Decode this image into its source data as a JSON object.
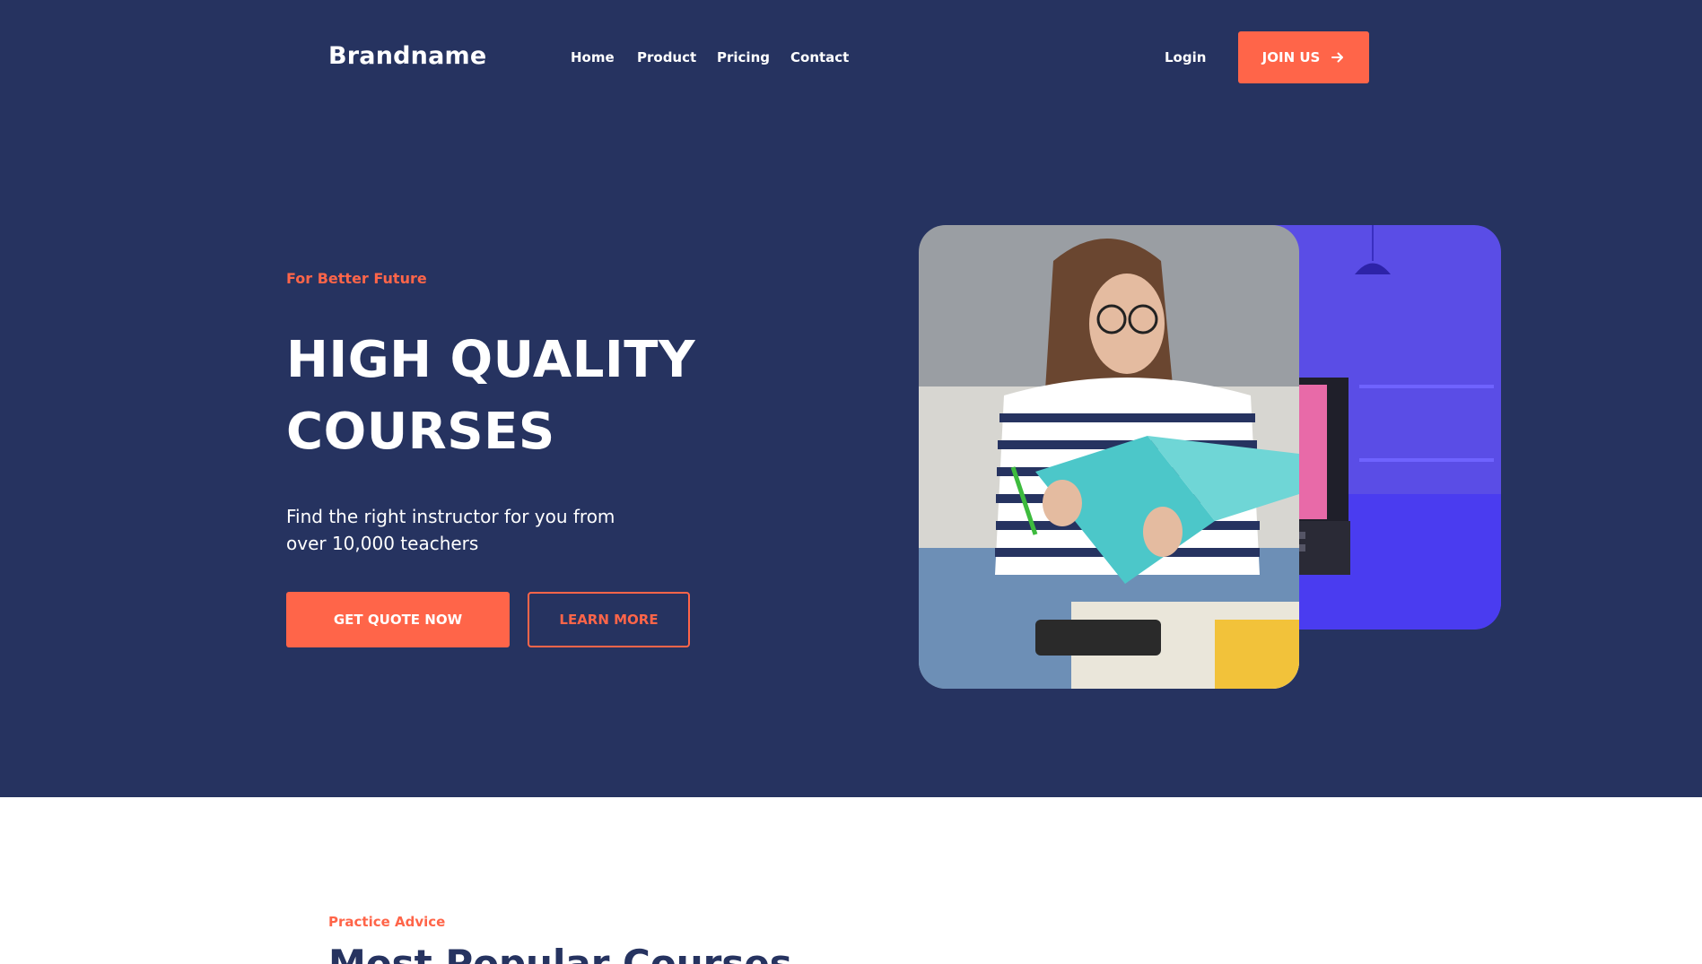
{
  "header": {
    "brand": "Brandname",
    "nav": [
      "Home",
      "Product",
      "Pricing",
      "Contact"
    ],
    "login": "Login",
    "join_label": "JOIN US",
    "join_icon": "arrow-right-icon"
  },
  "hero": {
    "eyebrow": "For Better Future",
    "headline": [
      "HIGH QUALITY",
      "COURSES"
    ],
    "subtitle": [
      "Find the right instructor for you from",
      "over 10,000 teachers"
    ],
    "primary_button": "GET QUOTE NOW",
    "secondary_button": "LEARN MORE",
    "images": [
      "woman-reading-notebook-photo",
      "laptop-purple-room-illustration"
    ]
  },
  "section2": {
    "eyebrow": "Practice Advice",
    "title": "Most Popular Courses"
  },
  "colors": {
    "hero_bg": "#263360",
    "accent": "#ff6549",
    "text_light": "#ffffff",
    "purple": "#5a4de6"
  }
}
